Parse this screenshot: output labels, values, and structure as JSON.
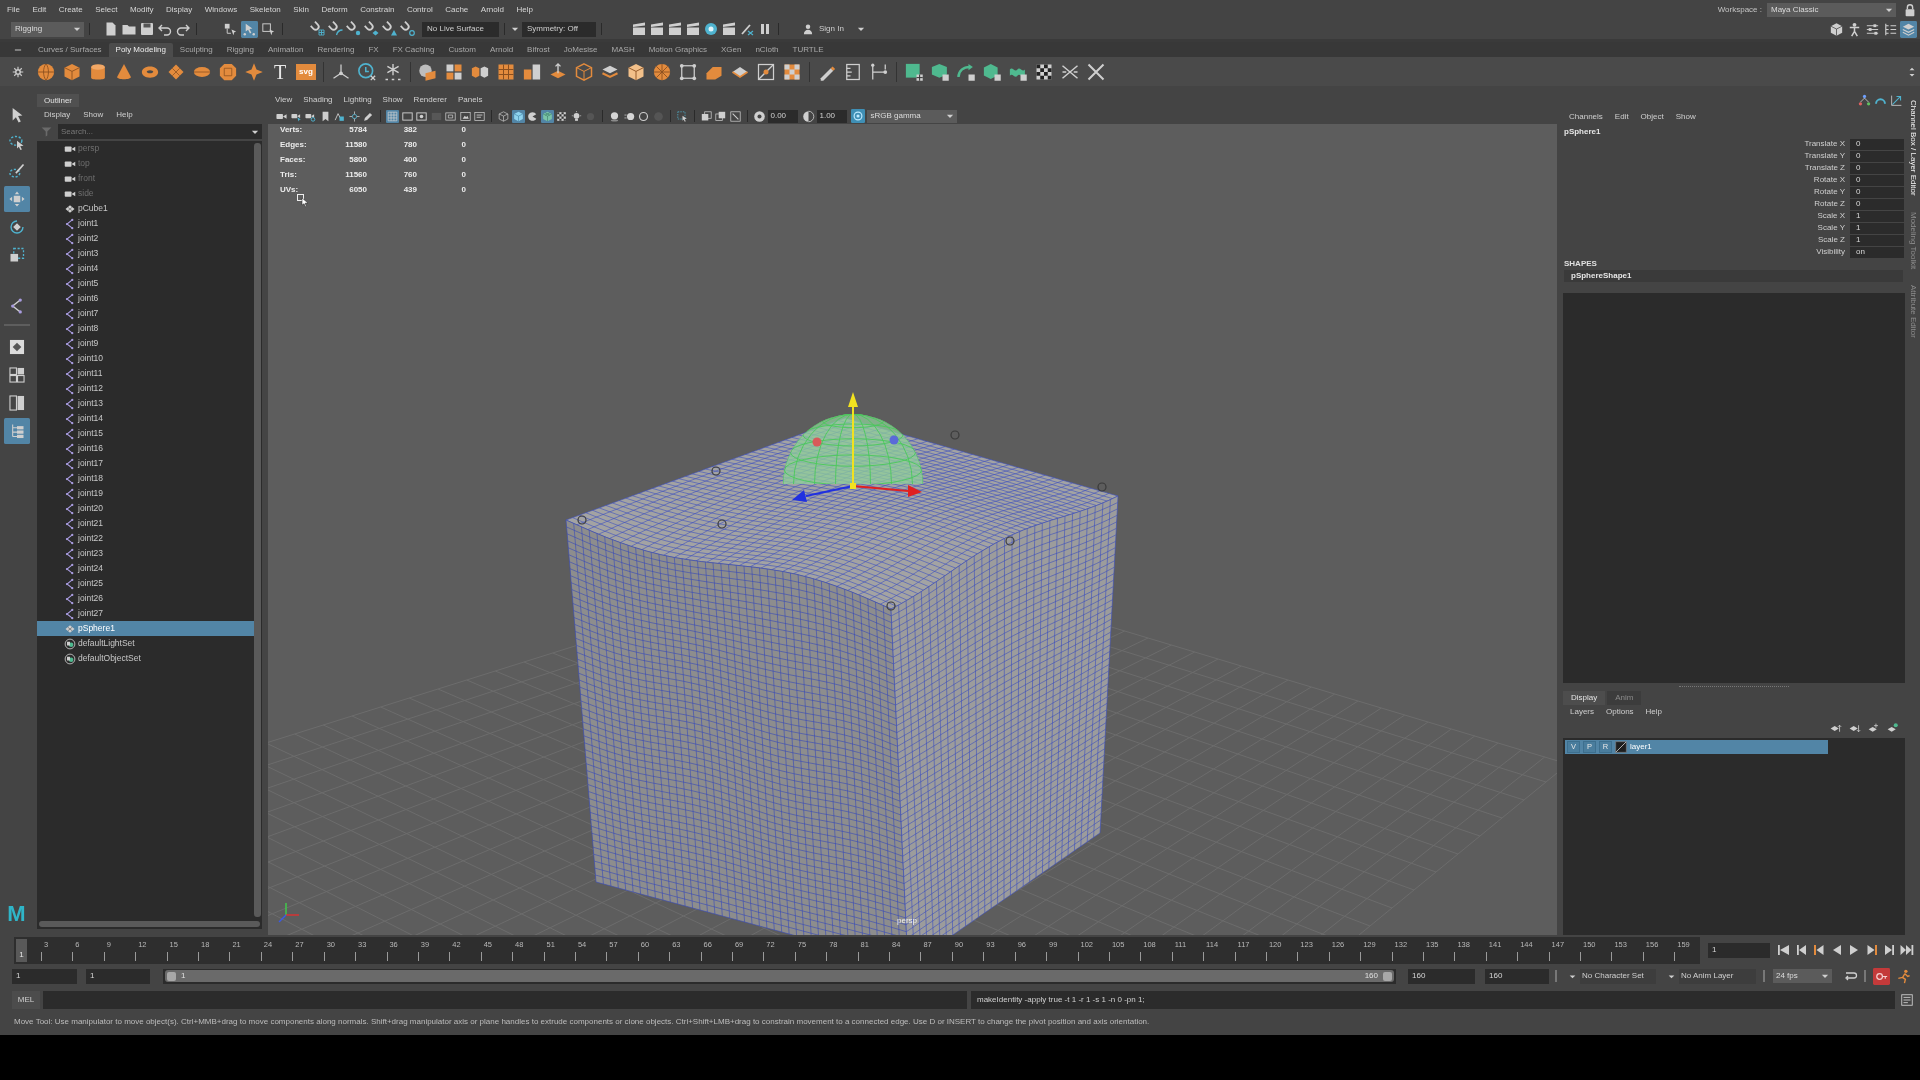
{
  "menu_bar": {
    "items": [
      "File",
      "Edit",
      "Create",
      "Select",
      "Modify",
      "Display",
      "Windows",
      "Skeleton",
      "Skin",
      "Deform",
      "Constrain",
      "Control",
      "Cache",
      "Arnold",
      "Help"
    ]
  },
  "workspace": {
    "label": "Workspace :",
    "value": "Maya Classic"
  },
  "status_line": {
    "menu_set": "Rigging",
    "masks": [
      {
        "kind": "hierarchy",
        "on": false
      },
      {
        "kind": "object",
        "on": true
      },
      {
        "kind": "component",
        "on": false
      }
    ],
    "live_surface": "No Live Surface",
    "symmetry": "Symmetry: Off",
    "sign_in": "Sign In",
    "panels": [
      {
        "kind": "toolkit",
        "on": false
      },
      {
        "kind": "figure",
        "on": false
      },
      {
        "kind": "sliders",
        "on": false
      },
      {
        "kind": "attributes",
        "on": false
      },
      {
        "kind": "channels",
        "on": true
      }
    ]
  },
  "shelf": {
    "tabs": [
      {
        "label": "Curves / Surfaces",
        "selected": false
      },
      {
        "label": "Poly Modeling",
        "selected": true
      },
      {
        "label": "Sculpting",
        "selected": false
      },
      {
        "label": "Rigging",
        "selected": false
      },
      {
        "label": "Animation",
        "selected": false
      },
      {
        "label": "Rendering",
        "selected": false
      },
      {
        "label": "FX",
        "selected": false
      },
      {
        "label": "FX Caching",
        "selected": false
      },
      {
        "label": "Custom",
        "selected": false
      },
      {
        "label": "Arnold",
        "selected": false
      },
      {
        "label": "Bifrost",
        "selected": false
      },
      {
        "label": "JoMesise",
        "selected": false
      },
      {
        "label": "MASH",
        "selected": false
      },
      {
        "label": "Motion Graphics",
        "selected": false
      },
      {
        "label": "XGen",
        "selected": false
      },
      {
        "label": "nCloth",
        "selected": false
      },
      {
        "label": "TURTLE",
        "selected": false
      }
    ],
    "text_buttons": [
      "T",
      "svg"
    ]
  },
  "toolbox": {
    "tools": [
      {
        "kind": "select",
        "selected": false
      },
      {
        "kind": "lasso",
        "selected": false
      },
      {
        "kind": "paint",
        "selected": false
      },
      {
        "kind": "move",
        "selected": true
      },
      {
        "kind": "rotate",
        "selected": false
      },
      {
        "kind": "scale",
        "selected": false
      },
      {
        "kind": "joint",
        "selected": false
      }
    ],
    "layouts": [
      {
        "kind": "single",
        "selected": false
      },
      {
        "kind": "four",
        "selected": false
      },
      {
        "kind": "two",
        "selected": false
      },
      {
        "kind": "outliner",
        "selected": true
      }
    ],
    "logo": "M"
  },
  "outliner": {
    "title": "Outliner",
    "menu": [
      "Display",
      "Show",
      "Help"
    ],
    "search": {
      "placeholder": "Search..."
    },
    "items": [
      {
        "kind": "camera",
        "label": "persp",
        "hidden": true,
        "selected": false
      },
      {
        "kind": "camera",
        "label": "top",
        "hidden": true,
        "selected": false
      },
      {
        "kind": "camera",
        "label": "front",
        "hidden": true,
        "selected": false
      },
      {
        "kind": "camera",
        "label": "side",
        "hidden": true,
        "selected": false
      },
      {
        "kind": "mesh",
        "label": "pCube1",
        "hidden": false,
        "selected": false
      },
      {
        "kind": "joint",
        "label": "joint1",
        "hidden": false,
        "selected": false
      },
      {
        "kind": "joint",
        "label": "joint2",
        "hidden": false,
        "selected": false
      },
      {
        "kind": "joint",
        "label": "joint3",
        "hidden": false,
        "selected": false
      },
      {
        "kind": "joint",
        "label": "joint4",
        "hidden": false,
        "selected": false
      },
      {
        "kind": "joint",
        "label": "joint5",
        "hidden": false,
        "selected": false
      },
      {
        "kind": "joint",
        "label": "joint6",
        "hidden": false,
        "selected": false
      },
      {
        "kind": "joint",
        "label": "joint7",
        "hidden": false,
        "selected": false
      },
      {
        "kind": "joint",
        "label": "joint8",
        "hidden": false,
        "selected": false
      },
      {
        "kind": "joint",
        "label": "joint9",
        "hidden": false,
        "selected": false
      },
      {
        "kind": "joint",
        "label": "joint10",
        "hidden": false,
        "selected": false
      },
      {
        "kind": "joint",
        "label": "joint11",
        "hidden": false,
        "selected": false
      },
      {
        "kind": "joint",
        "label": "joint12",
        "hidden": false,
        "selected": false
      },
      {
        "kind": "joint",
        "label": "joint13",
        "hidden": false,
        "selected": false
      },
      {
        "kind": "joint",
        "label": "joint14",
        "hidden": false,
        "selected": false
      },
      {
        "kind": "joint",
        "label": "joint15",
        "hidden": false,
        "selected": false
      },
      {
        "kind": "joint",
        "label": "joint16",
        "hidden": false,
        "selected": false
      },
      {
        "kind": "joint",
        "label": "joint17",
        "hidden": false,
        "selected": false
      },
      {
        "kind": "joint",
        "label": "joint18",
        "hidden": false,
        "selected": false
      },
      {
        "kind": "joint",
        "label": "joint19",
        "hidden": false,
        "selected": false
      },
      {
        "kind": "joint",
        "label": "joint20",
        "hidden": false,
        "selected": false
      },
      {
        "kind": "joint",
        "label": "joint21",
        "hidden": false,
        "selected": false
      },
      {
        "kind": "joint",
        "label": "joint22",
        "hidden": false,
        "selected": false
      },
      {
        "kind": "joint",
        "label": "joint23",
        "hidden": false,
        "selected": false
      },
      {
        "kind": "joint",
        "label": "joint24",
        "hidden": false,
        "selected": false
      },
      {
        "kind": "joint",
        "label": "joint25",
        "hidden": false,
        "selected": false
      },
      {
        "kind": "joint",
        "label": "joint26",
        "hidden": false,
        "selected": false
      },
      {
        "kind": "joint",
        "label": "joint27",
        "hidden": false,
        "selected": false
      },
      {
        "kind": "mesh",
        "label": "pSphere1",
        "hidden": false,
        "selected": true
      },
      {
        "kind": "set",
        "label": "defaultLightSet",
        "hidden": false,
        "selected": false
      },
      {
        "kind": "set",
        "label": "defaultObjectSet",
        "hidden": false,
        "selected": false
      }
    ]
  },
  "viewport": {
    "menu": [
      "View",
      "Shading",
      "Lighting",
      "Show",
      "Renderer",
      "Panels"
    ],
    "toolbar": [
      [
        {
          "kind": "camera",
          "on": false
        },
        {
          "kind": "camera_select",
          "on": false
        },
        {
          "kind": "camera_attributes",
          "on": false
        },
        {
          "kind": "bookmark",
          "on": false
        },
        {
          "kind": "image_plane",
          "on": false
        },
        {
          "kind": "pan",
          "on": false
        },
        {
          "kind": "pencil",
          "on": false
        }
      ],
      [
        {
          "kind": "grid",
          "on": true
        },
        {
          "kind": "film_gate",
          "on": false
        },
        {
          "kind": "resolution_gate",
          "on": false
        },
        {
          "kind": "gate_mask",
          "on": false
        },
        {
          "kind": "field_chart",
          "on": false
        },
        {
          "kind": "safe_action",
          "on": false
        },
        {
          "kind": "safe_title",
          "on": false
        }
      ],
      [
        {
          "kind": "wireframe",
          "on": false
        },
        {
          "kind": "smooth_shade",
          "on": true
        },
        {
          "kind": "default_material",
          "on": false
        },
        {
          "kind": "textured",
          "on": true
        },
        {
          "kind": "checker",
          "on": false
        },
        {
          "kind": "lights",
          "on": false
        },
        {
          "kind": "shadows",
          "on": false
        }
      ],
      [
        {
          "kind": "occlusion",
          "on": false
        },
        {
          "kind": "motion_blur",
          "on": false
        },
        {
          "kind": "antialias",
          "on": false
        },
        {
          "kind": "depth_of_field",
          "on": false
        }
      ],
      [
        {
          "kind": "isolate",
          "on": false
        }
      ],
      [
        {
          "kind": "xray",
          "on": false
        },
        {
          "kind": "xray_joints",
          "on": false
        },
        {
          "kind": "xray_active",
          "on": false
        }
      ]
    ],
    "exposure": "0.00",
    "gamma": "1.00",
    "color_management": true,
    "view_transform": "sRGB gamma",
    "heads_up": [
      {
        "label": "Verts:",
        "values": [
          "5784",
          "382",
          "0"
        ]
      },
      {
        "label": "Edges:",
        "values": [
          "11580",
          "780",
          "0"
        ]
      },
      {
        "label": "Faces:",
        "values": [
          "5800",
          "400",
          "0"
        ]
      },
      {
        "label": "Tris:",
        "values": [
          "11560",
          "760",
          "0"
        ]
      },
      {
        "label": "UVs:",
        "values": [
          "6050",
          "439",
          "0"
        ]
      }
    ],
    "camera": "persp"
  },
  "channel_box": {
    "menu": [
      "Channels",
      "Edit",
      "Object",
      "Show"
    ],
    "object": "pSphere1",
    "attributes": [
      {
        "name": "Translate X",
        "value": "0"
      },
      {
        "name": "Translate Y",
        "value": "0"
      },
      {
        "name": "Translate Z",
        "value": "0"
      },
      {
        "name": "Rotate X",
        "value": "0"
      },
      {
        "name": "Rotate Y",
        "value": "0"
      },
      {
        "name": "Rotate Z",
        "value": "0"
      },
      {
        "name": "Scale X",
        "value": "1"
      },
      {
        "name": "Scale Y",
        "value": "1"
      },
      {
        "name": "Scale Z",
        "value": "1"
      },
      {
        "name": "Visibility",
        "value": "on"
      }
    ],
    "shapes_heading": "SHAPES",
    "shape": "pSphereShape1"
  },
  "layer_editor": {
    "tabs": [
      {
        "label": "Display",
        "selected": true
      },
      {
        "label": "Anim",
        "selected": false
      }
    ],
    "menu": [
      "Layers",
      "Options",
      "Help"
    ],
    "layers": [
      {
        "flags": [
          "V",
          "P",
          "R"
        ],
        "name": "layer1",
        "selected": true
      }
    ]
  },
  "side_tabs": [
    {
      "label": "Channel Box / Layer Editor",
      "selected": true
    },
    {
      "label": "Modeling Toolkit",
      "selected": false
    },
    {
      "label": "Attribute Editor",
      "selected": false
    }
  ],
  "timeline": {
    "ticks": [
      "3",
      "6",
      "9",
      "12",
      "15",
      "18",
      "21",
      "24",
      "27",
      "30",
      "33",
      "36",
      "39",
      "42",
      "45",
      "48",
      "51",
      "54",
      "57",
      "60",
      "63",
      "66",
      "69",
      "72",
      "75",
      "78",
      "81",
      "84",
      "87",
      "90",
      "93",
      "96",
      "99",
      "102",
      "105",
      "108",
      "111",
      "114",
      "117",
      "120",
      "123",
      "126",
      "129",
      "132",
      "135",
      "138",
      "141",
      "144",
      "147",
      "150",
      "153",
      "156",
      "159"
    ],
    "current_frame": "1",
    "level": 0,
    "frame_field": "1"
  },
  "range_slider": {
    "scene_start": "1",
    "playback_start": "1",
    "range_start": "1",
    "range_end": "160",
    "playback_end": "160",
    "scene_end": "160",
    "character_set": "No Character Set",
    "anim_layer": "No Anim Layer",
    "fps": "24 fps",
    "auto_key": true
  },
  "command_line": {
    "language": "MEL",
    "result": "makeIdentity -apply true -t 1 -r 1 -s 1 -n 0 -pn 1;"
  },
  "help_line": "Move Tool: Use manipulator to move object(s). Ctrl+MMB+drag to move components along normals. Shift+drag manipulator axis or plane handles to extrude components or clone objects. Ctrl+Shift+LMB+drag to constrain movement to a connected edge. Use D or INSERT to change the pivot position and axis orientation."
}
